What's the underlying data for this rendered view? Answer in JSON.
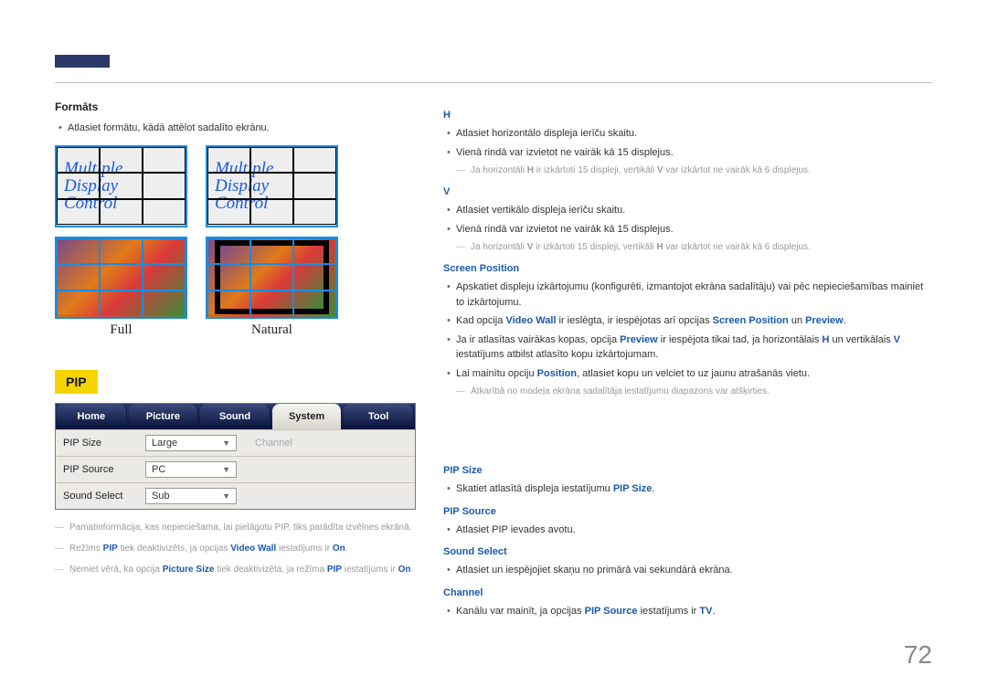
{
  "page_num": "72",
  "left": {
    "formats_h": "Formāts",
    "formats_desc": "Atlasiet formātu, kādā attēlot sadalīto ekrānu.",
    "mdc_line1": "Multiple",
    "mdc_line2": "Display",
    "mdc_line3": "Control",
    "cap_full": "Full",
    "cap_natural": "Natural",
    "pip_label": "PIP",
    "tabs": {
      "home": "Home",
      "picture": "Picture",
      "sound": "Sound",
      "system": "System",
      "tool": "Tool"
    },
    "rows": {
      "size_lbl": "PIP Size",
      "size_val": "Large",
      "channel_lbl": "Channel",
      "src_lbl": "PIP Source",
      "src_val": "PC",
      "ssel_lbl": "Sound Select",
      "ssel_val": "Sub"
    },
    "note1a": "Pamatinformācija, kas nepieciešama, lai pielāgotu PIP, tiks parādīta izvēlnes ekrānā.",
    "note2_pre": "Režīms ",
    "note2_pip": "PIP",
    "note2_mid": " tiek deaktivizēts, ja opcijas ",
    "note2_vw": "Video Wall",
    "note2_post": " iestatījums ir ",
    "note2_on": "On",
    "note2_dot": ".",
    "note3_pre": "Ņemiet vērā, ka opcija ",
    "note3_ps": "Picture Size",
    "note3_mid": " tiek deaktivizēta, ja režīma ",
    "note3_pip": "PIP",
    "note3_post": " iestatījums ir ",
    "note3_on": "On",
    "note3_dot": "."
  },
  "right": {
    "h": {
      "h": "H",
      "li1": "Atlasiet horizontālo displeja ierīču skaitu.",
      "li2": "Vienā rindā var izvietot ne vairāk kā 15 displejus.",
      "note_pre": "Ja horizontāli ",
      "note_h": "H",
      "note_mid": " ir izkārtoti 15 displeji, vertikāli ",
      "note_v": "V",
      "note_post": " var izkārtot ne vairāk kā 6 displejus."
    },
    "v": {
      "h": "V",
      "li1": "Atlasiet vertikālo displeja ierīču skaitu.",
      "li2": "Vienā rindā var izvietot ne vairāk kā 15 displejus.",
      "note_pre": "Ja horizontāli ",
      "note_v": "V",
      "note_mid": " ir izkārtoti 15 displeji, vertikāli ",
      "note_h": "H",
      "note_post": " var izkārtot ne vairāk kā 6 displejus."
    },
    "sp": {
      "h": "Screen Position",
      "li1": "Apskatiet displeju izkārtojumu (konfigurēti, izmantojot ekrāna sadalītāju) vai pēc nepieciešamības mainiet to izkārtojumu.",
      "li2_pre": "Kad opcija ",
      "li2_vw": "Video Wall",
      "li2_mid": " ir ieslēgta, ir iespējotas arī opcijas ",
      "li2_sp": "Screen Position",
      "li2_and": " un ",
      "li2_pv": "Preview",
      "li2_dot": ".",
      "li3_pre": "Ja ir atlasītas vairākas kopas, opcija ",
      "li3_pv": "Preview",
      "li3_mid": " ir iespējota tikai tad, ja horizontālais ",
      "li3_h": "H",
      "li3_mid2": " un vertikālais ",
      "li3_v": "V",
      "li3_post": " iestatījums atbilst atlasīto kopu izkārtojumam.",
      "li4_pre": "Lai mainītu opciju ",
      "li4_pos": "Position",
      "li4_post": ", atlasiet kopu un velciet to uz jaunu atrašanās vietu.",
      "note": "Atkarībā no modeļa ekrāna sadalītāja iestatījumu diapazons var atšķirties."
    },
    "pipsize": {
      "h": "PIP Size",
      "li_pre": "Skatiet atlasītā displeja iestatījumu ",
      "li_b": "PIP Size",
      "li_dot": "."
    },
    "pipsrc": {
      "h": "PIP Source",
      "li": "Atlasiet PIP ievades avotu."
    },
    "ssel": {
      "h": "Sound Select",
      "li": "Atlasiet un iespējojiet skaņu no primārā vai sekundārā ekrāna."
    },
    "chan": {
      "h": "Channel",
      "li_pre": "Kanālu var mainīt, ja opcijas ",
      "li_b": "PIP Source",
      "li_mid": " iestatījums ir ",
      "li_tv": "TV",
      "li_dot": "."
    }
  }
}
